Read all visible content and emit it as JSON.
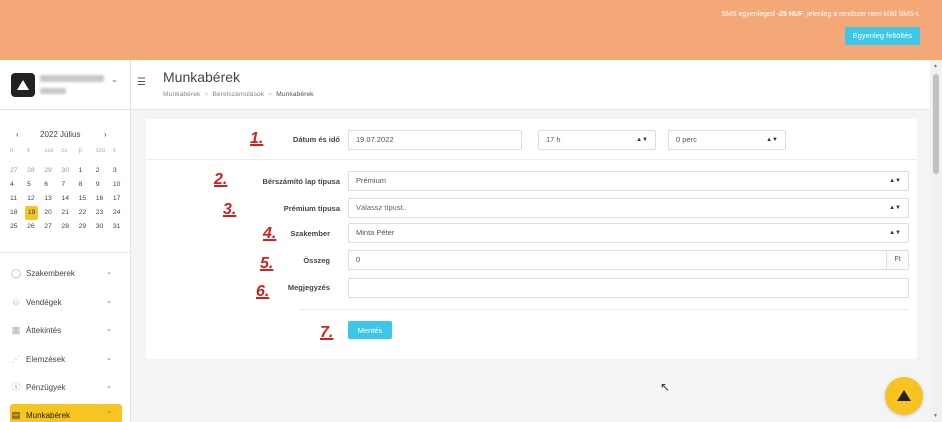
{
  "banner": {
    "sms_prefix": "SMS egyenleged ",
    "sms_amount": "-25 HUF",
    "sms_suffix": ", jelenleg a rendszer nem küld SMS-t.",
    "topup_label": "Egyenleg feltöltés"
  },
  "calendar": {
    "title": "2022 Július",
    "prev": "‹",
    "next": "›",
    "weekdays": [
      "h",
      "k",
      "sze",
      "cs",
      "p",
      "szo",
      "v"
    ],
    "weeks": [
      [
        "27",
        "28",
        "29",
        "30",
        "1",
        "2",
        "3"
      ],
      [
        "4",
        "5",
        "6",
        "7",
        "8",
        "9",
        "10"
      ],
      [
        "11",
        "12",
        "13",
        "14",
        "15",
        "16",
        "17"
      ],
      [
        "18",
        "19",
        "20",
        "21",
        "22",
        "23",
        "24"
      ],
      [
        "25",
        "26",
        "27",
        "28",
        "29",
        "30",
        "31"
      ]
    ],
    "today": "19"
  },
  "nav": {
    "items": [
      {
        "label": "Szakemberek",
        "icon": "person-icon"
      },
      {
        "label": "Vendégek",
        "icon": "users-icon"
      },
      {
        "label": "Áttekintés",
        "icon": "grid-icon"
      },
      {
        "label": "Elemzések",
        "icon": "chart-icon"
      },
      {
        "label": "Pénzügyek",
        "icon": "coin-icon"
      },
      {
        "label": "Munkabérek",
        "icon": "payroll-icon",
        "active": true
      }
    ]
  },
  "header": {
    "title": "Munkabérek",
    "breadcrumb": [
      "Munkabérek",
      "Bérelszámolások",
      "Munkabérek"
    ]
  },
  "form": {
    "date_label": "Dátum és idő",
    "date_value": "19.07.2022",
    "hour_value": "17 h",
    "minute_value": "0 perc",
    "sheet_type_label": "Bérszámító lap típusa",
    "sheet_type_value": "Prémium",
    "premium_type_label": "Prémium típusa",
    "premium_type_placeholder": "Válassz típust..",
    "specialist_label": "Szakember",
    "specialist_value": "Minta Péter",
    "amount_label": "Összeg",
    "amount_value": "0",
    "amount_suffix": "Ft",
    "note_label": "Megjegyzés",
    "note_value": "",
    "save_label": "Mentés"
  },
  "annotations": [
    "1.",
    "2.",
    "3.",
    "4.",
    "5.",
    "6.",
    "7."
  ],
  "colors": {
    "banner": "#f4a878",
    "accent": "#3cc6e8",
    "active": "#f7c522",
    "annotation": "#d41f1f"
  }
}
